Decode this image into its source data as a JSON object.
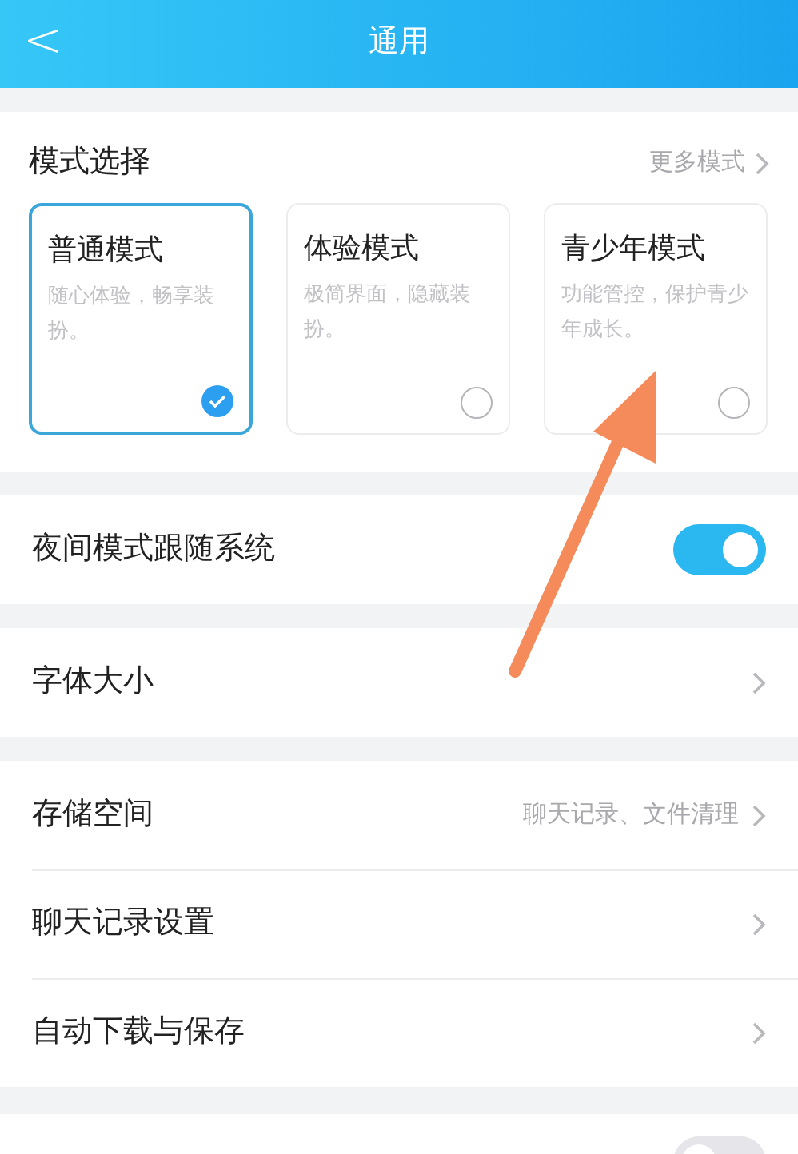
{
  "header": {
    "title": "通用",
    "back": "<"
  },
  "mode_section": {
    "title": "模式选择",
    "more": "更多模式",
    "cards": [
      {
        "title": "普通模式",
        "description": "随心体验，畅享装扮。",
        "selected": true
      },
      {
        "title": "体验模式",
        "description": "极简界面，隐藏装扮。",
        "selected": false
      },
      {
        "title": "青少年模式",
        "description": "功能管控，保护青少年成长。",
        "selected": false
      }
    ]
  },
  "groups": [
    [
      {
        "kind": "toggle",
        "label": "夜间模式跟随系统",
        "on": true
      }
    ],
    [
      {
        "kind": "link",
        "label": "字体大小"
      }
    ],
    [
      {
        "kind": "link",
        "label": "存储空间",
        "value": "聊天记录、文件清理"
      },
      {
        "kind": "link",
        "label": "聊天记录设置"
      },
      {
        "kind": "link",
        "label": "自动下载与保存"
      }
    ]
  ],
  "bottom_row": {
    "on": false
  },
  "annotation": {
    "kind": "arrow"
  }
}
